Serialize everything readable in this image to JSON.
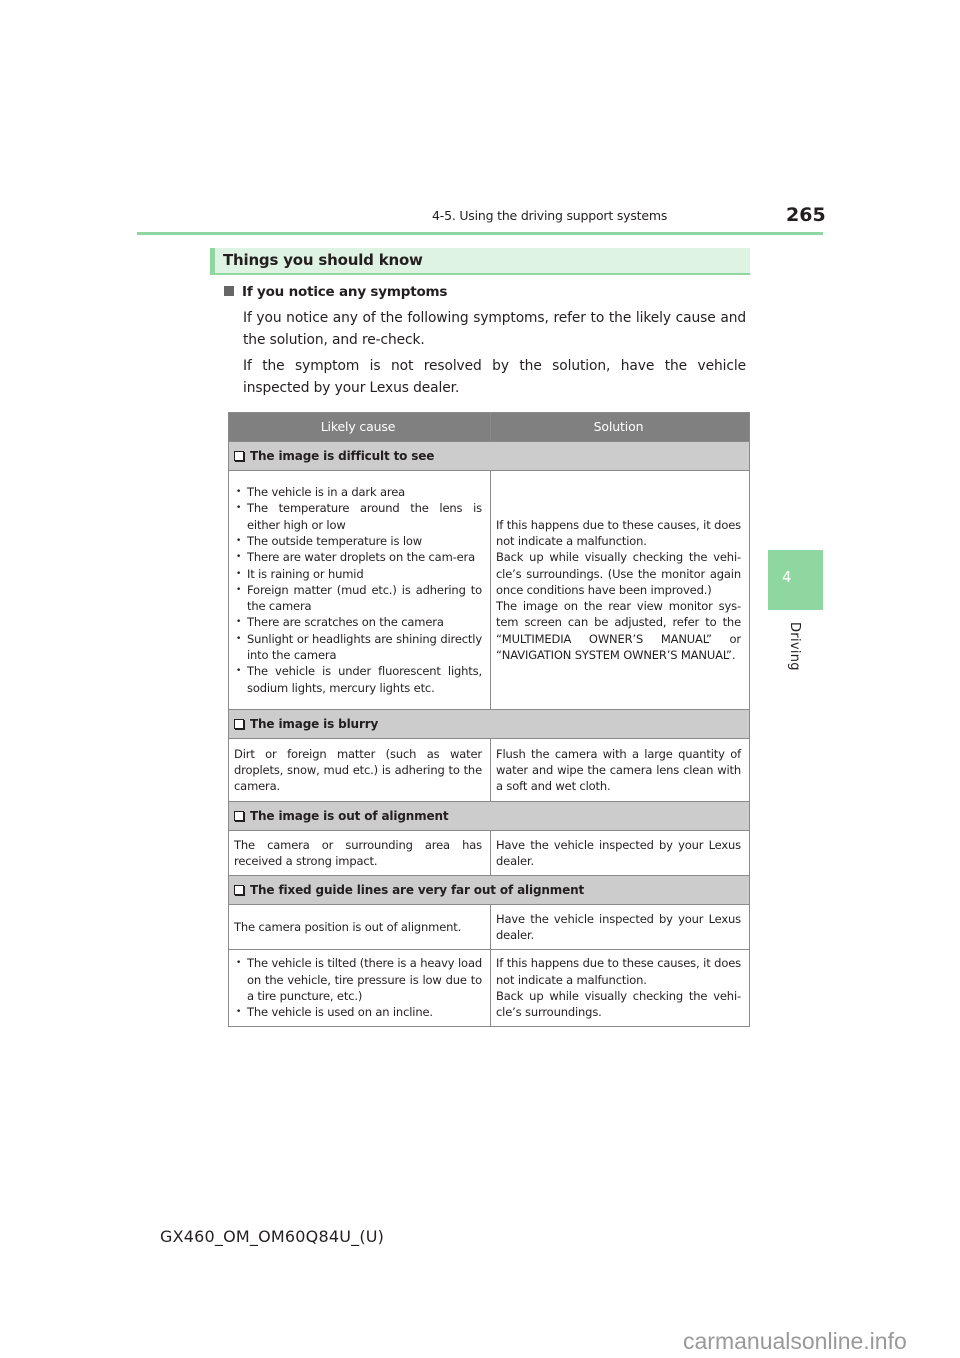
{
  "header": {
    "section": "4-5. Using the driving support systems",
    "page_number": "265"
  },
  "side_tab": {
    "chapter_number": "4",
    "chapter_label": "Driving"
  },
  "section_banner": {
    "title": "Things you should know"
  },
  "intro": {
    "subheading": "If you notice any symptoms",
    "paragraph1": "If you notice any of the following symptoms, refer to the likely cause and the solution, and re-check.",
    "paragraph2": "If the symptom is not resolved by the solution, have the vehicle inspected by your Lexus dealer."
  },
  "table": {
    "headers": [
      "Likely cause",
      "Solution"
    ],
    "categories": [
      {
        "title": "The image is difficult to see",
        "rows": [
          {
            "causes": [
              "The vehicle is in a dark area",
              "The temperature around the lens is either high or low",
              "The outside temperature is low",
              "There are water droplets on the cam-era",
              "It is raining or humid",
              "Foreign matter (mud etc.) is adhering to the camera",
              "There are scratches on the camera",
              "Sunlight or headlights are shining directly into the camera",
              "The vehicle is under fluorescent lights, sodium lights, mercury lights etc."
            ],
            "solution": [
              "If this happens due to these causes, it does not indicate a malfunction.",
              "Back up while visually checking the vehi-cle’s surroundings. (Use the monitor again once conditions have been improved.)",
              "The image on the rear view monitor sys-tem screen can be adjusted, refer to the “MULTIMEDIA OWNER’S MANUAL” or “NAVIGATION SYSTEM OWNER’S MANUAL”."
            ]
          }
        ]
      },
      {
        "title": "The image is blurry",
        "rows": [
          {
            "cause": "Dirt or foreign matter (such as water droplets, snow, mud etc.) is adhering to the camera.",
            "solution": "Flush the camera with a large quantity of water and wipe the camera lens clean with a soft and wet cloth."
          }
        ]
      },
      {
        "title": "The image is out of alignment",
        "rows": [
          {
            "cause": "The camera or surrounding area has received a strong impact.",
            "solution": "Have the vehicle inspected by your Lexus dealer."
          }
        ]
      },
      {
        "title": "The fixed guide lines are very far out of alignment",
        "rows": [
          {
            "cause": "The camera position is out of alignment.",
            "solution": "Have the vehicle inspected by your Lexus dealer."
          },
          {
            "causes": [
              "The vehicle is tilted (there is a heavy load on the vehicle, tire pressure is low due to a tire puncture, etc.)",
              "The vehicle is used on an incline."
            ],
            "solution": [
              "If this happens due to these causes, it does not indicate a malfunction.",
              "Back up while visually checking the vehi-cle’s surroundings."
            ]
          }
        ]
      }
    ]
  },
  "footer": {
    "document_code": "GX460_OM_OM60Q84U_(U)",
    "watermark": "carmanualsonline.info"
  },
  "colors": {
    "accent_green": "#8fd7a1",
    "banner_bg": "#dff3e2",
    "table_header_bg": "#808080",
    "category_row_bg": "#cccccc"
  }
}
